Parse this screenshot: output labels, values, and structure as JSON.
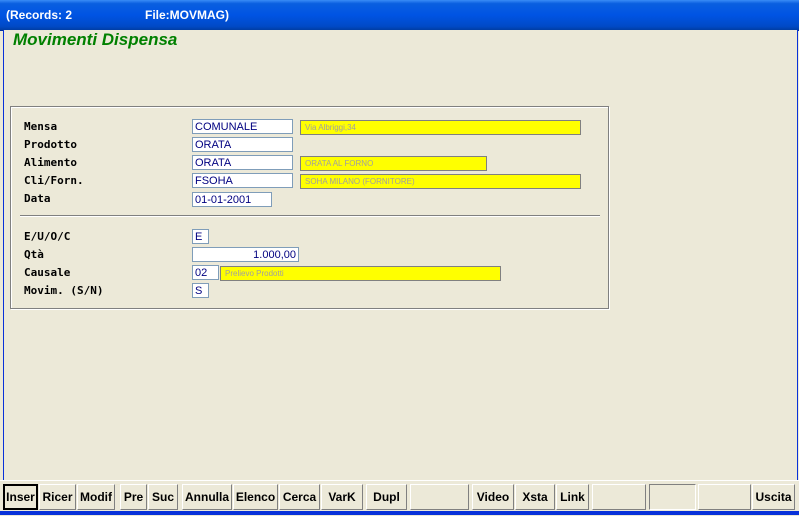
{
  "titlebar": {
    "records": "(Records: 2",
    "file": "File:MOVMAG)"
  },
  "form": {
    "title": "Movimenti Dispensa"
  },
  "fields": {
    "mensa": {
      "label": "Mensa",
      "value": "COMUNALE",
      "desc": "Via Albriggi,34"
    },
    "prodotto": {
      "label": "Prodotto",
      "value": "ORATA"
    },
    "alimento": {
      "label": "Alimento",
      "value": "ORATA",
      "desc": "ORATA AL FORNO"
    },
    "cliforn": {
      "label": "Cli/Forn.",
      "value": "FSOHA",
      "desc": "SOHA MILANO (FORNITORE)"
    },
    "data": {
      "label": "Data",
      "value": "01-01-2001"
    },
    "euoc": {
      "label": "E/U/O/C",
      "value": "E"
    },
    "qta": {
      "label": "Qtà",
      "value": "1.000,00"
    },
    "causale": {
      "label": "Causale",
      "value": "02",
      "desc": "Prelievo Prodotti"
    },
    "movim": {
      "label": "Movim. (S/N)",
      "value": "S"
    }
  },
  "toolbar": {
    "inser": "Inser",
    "ricer": "Ricer",
    "modif": "Modif",
    "pre": "Pre",
    "suc": "Suc",
    "annulla": "Annulla",
    "elenco": "Elenco",
    "cerca": "Cerca",
    "vark": "VarK",
    "dupl": "Dupl",
    "video": "Video",
    "xsta": "Xsta",
    "link": "Link",
    "uscita": "Uscita"
  }
}
